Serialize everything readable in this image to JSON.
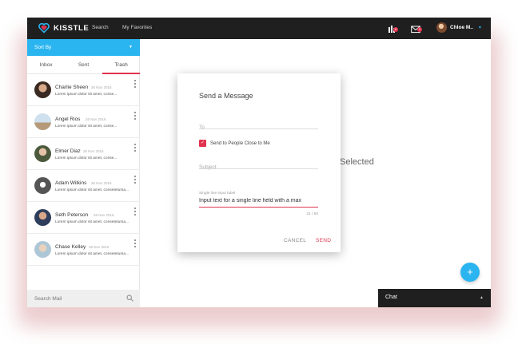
{
  "app": {
    "brand": "KISSTLE",
    "nav": [
      "Search",
      "My Favorites"
    ],
    "notifications": {
      "activity_badge": "9",
      "mail_badge": "2"
    },
    "user": {
      "name": "Chloe M.."
    }
  },
  "colors": {
    "accent_blue": "#2bb5f0",
    "accent_red": "#e0334f",
    "topbar": "#1f1f1f"
  },
  "sidebar": {
    "sort_label": "Sort By",
    "tabs": [
      {
        "label": "Inbox",
        "active": false
      },
      {
        "label": "Sent",
        "active": false
      },
      {
        "label": "Trash",
        "active": true
      }
    ],
    "messages": [
      {
        "name": "Charlie Sheen",
        "date": "26 Nov 2016",
        "preview": "Lorem ipsum dolor sit amet, conse..."
      },
      {
        "name": "Angel Rios",
        "date": "26 Nov 2016",
        "preview": "Lorem ipsum dolor sit amet, conse..."
      },
      {
        "name": "Elmer Diaz",
        "date": "26 Nov 2016",
        "preview": "Lorem ipsum dolor sit amet, conse..."
      },
      {
        "name": "Adam Wilkins",
        "date": "26 Nov 2016",
        "preview": "Lorem ipsum dolor sit amet, consetetursa..."
      },
      {
        "name": "Seth Peterson",
        "date": "26 Nov 2016",
        "preview": "Lorem ipsum dolor sit amet, consetetursa..."
      },
      {
        "name": "Chase Kelley",
        "date": "26 Nov 2016",
        "preview": "Lorem ipsum dolor sit amet, consetetursa..."
      }
    ],
    "search_placeholder": "Search Mail"
  },
  "main": {
    "background_text": "Selected",
    "fab_label": "+",
    "chat_label": "Chat"
  },
  "dialog": {
    "title": "Send a Message",
    "to_placeholder": "To",
    "checkbox_label": "Send to People Close to Me",
    "checkbox_checked": true,
    "subject_placeholder": "Subject",
    "input_label": "Single line input label",
    "input_value": "Input text for a single line field with a max",
    "char_count": "31 / 50",
    "cancel_label": "CANCEL",
    "send_label": "SEND"
  }
}
